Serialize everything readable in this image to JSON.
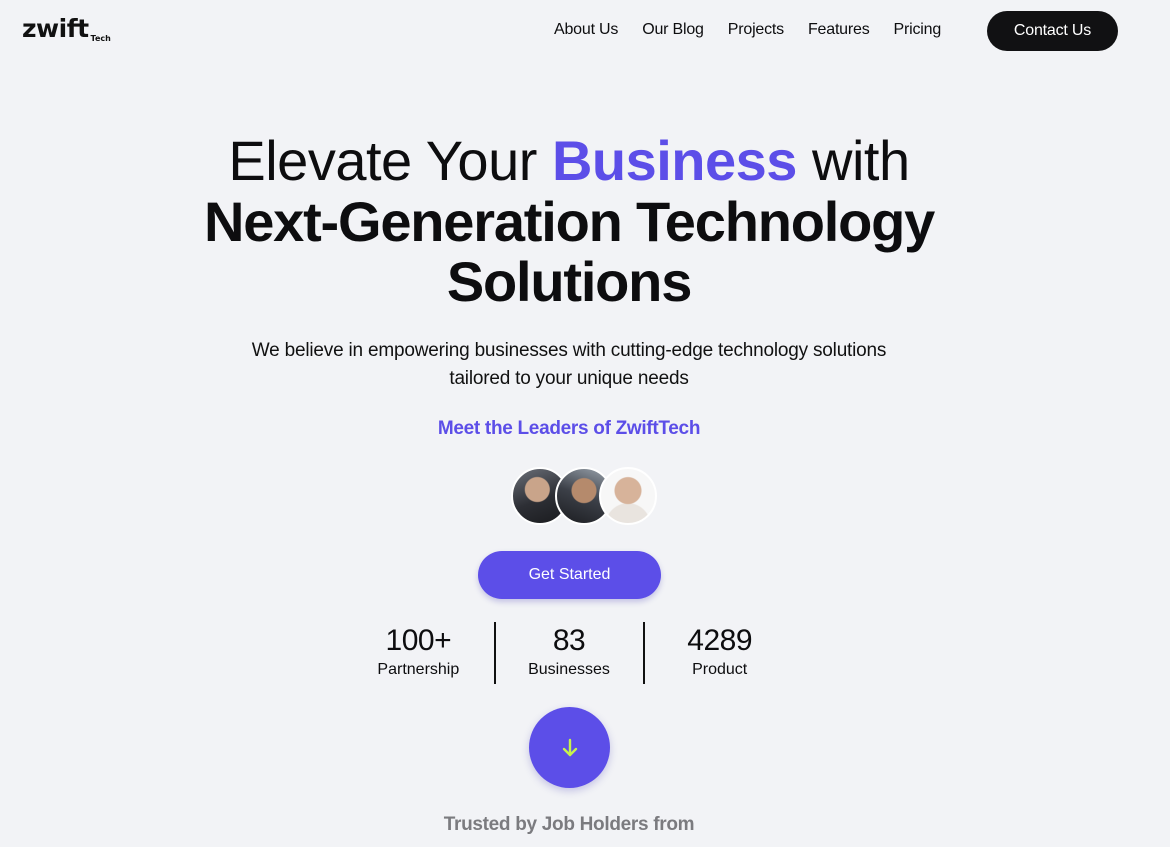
{
  "nav": {
    "logo_text": "zwift",
    "logo_sub": "Tech",
    "links": [
      "About Us",
      "Our Blog",
      "Projects",
      "Features",
      "Pricing"
    ],
    "contact_label": "Contact Us"
  },
  "hero": {
    "title_part1": "Elevate Your ",
    "title_accent": "Business",
    "title_part2": " with",
    "title_line2": "Next-Generation Technology",
    "title_line3": "Solutions",
    "subtitle_line1": "We believe in empowering businesses with cutting-edge technology solutions",
    "subtitle_line2": "tailored to your unique needs",
    "leaders_heading": "Meet the Leaders of ZwiftTech",
    "cta_label": "Get Started"
  },
  "stats": [
    {
      "value": "100+",
      "label": "Partnership"
    },
    {
      "value": "83",
      "label": "Businesses"
    },
    {
      "value": "4289",
      "label": "Product"
    }
  ],
  "scroll_icon": "arrow-down-icon",
  "trusted_heading": "Trusted by Job Holders from",
  "colors": {
    "accent": "#5c4ee8",
    "arrow": "#c6f24e",
    "dark": "#111113",
    "background": "#f2f3f6"
  }
}
